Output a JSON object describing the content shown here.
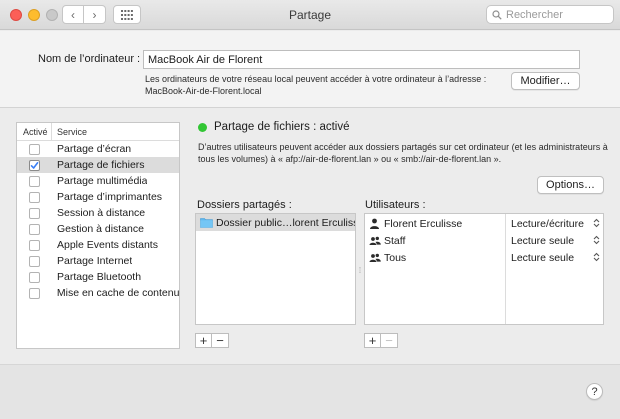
{
  "window": {
    "title": "Partage",
    "search_placeholder": "Rechercher",
    "nav_back": "‹",
    "nav_forward": "›"
  },
  "computer": {
    "name_label": "Nom de l’ordinateur :",
    "name_value": "MacBook Air de Florent",
    "address_line1": "Les ordinateurs de votre réseau local peuvent accéder à votre ordinateur à l’adresse :",
    "address_line2": "MacBook-Air-de-Florent.local",
    "modify_label": "Modifier…"
  },
  "services": {
    "header_active": "Activé",
    "header_service": "Service",
    "items": [
      {
        "label": "Partage d’écran",
        "checked": false
      },
      {
        "label": "Partage de fichiers",
        "checked": true
      },
      {
        "label": "Partage multimédia",
        "checked": false
      },
      {
        "label": "Partage d’imprimantes",
        "checked": false
      },
      {
        "label": "Session à distance",
        "checked": false
      },
      {
        "label": "Gestion à distance",
        "checked": false
      },
      {
        "label": "Apple Events distants",
        "checked": false
      },
      {
        "label": "Partage Internet",
        "checked": false
      },
      {
        "label": "Partage Bluetooth",
        "checked": false
      },
      {
        "label": "Mise en cache de contenu",
        "checked": false
      }
    ]
  },
  "detail": {
    "status": "Partage de fichiers : activé",
    "status_color": "#32c634",
    "description": "D’autres utilisateurs peuvent accéder aux dossiers partagés sur cet ordinateur (et les administrateurs à tous les volumes) à « afp://air-de-florent.lan » ou « smb://air-de-florent.lan ».",
    "options_label": "Options…",
    "folders_label": "Dossiers partagés :",
    "users_label": "Utilisateurs :",
    "folders": [
      "Dossier public…lorent Erculisse"
    ],
    "users": [
      {
        "name": "Florent Erculisse",
        "icon": "person-icon",
        "permission": "Lecture/écriture"
      },
      {
        "name": "Staff",
        "icon": "group-icon",
        "permission": "Lecture seule"
      },
      {
        "name": "Tous",
        "icon": "group-icon",
        "permission": "Lecture seule"
      }
    ],
    "add": "+",
    "remove": "−",
    "help": "?"
  }
}
